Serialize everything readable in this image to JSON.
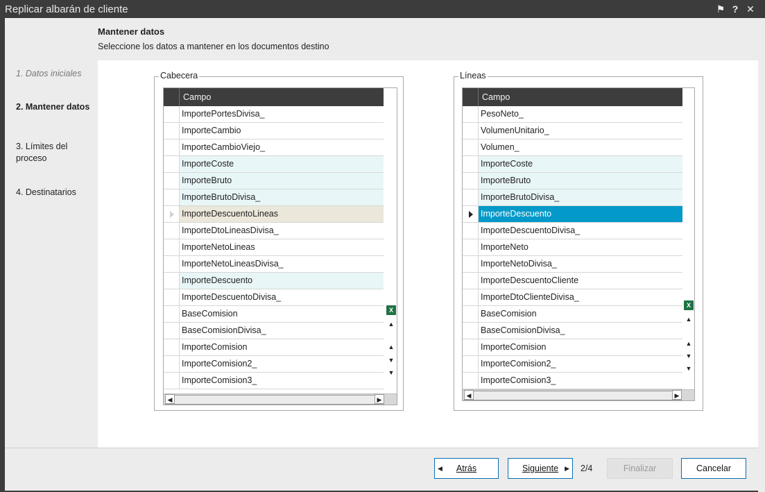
{
  "window": {
    "title": "Replicar albarán de cliente",
    "controls": {
      "pin": "⚑",
      "help": "?",
      "close": "✕"
    }
  },
  "header": {
    "title": "Mantener datos",
    "subtitle": "Seleccione los datos a mantener en los documentos destino"
  },
  "steps": [
    "1. Datos iniciales",
    "2. Mantener datos",
    "3. Límites del proceso",
    "4. Destinatarios"
  ],
  "cabecera": {
    "legend": "Cabecera",
    "column": "Campo",
    "rows": [
      {
        "value": "ImportePortesDivisa_",
        "state": "normal"
      },
      {
        "value": "ImporteCambio",
        "state": "normal"
      },
      {
        "value": "ImporteCambioViejo_",
        "state": "normal"
      },
      {
        "value": "ImporteCoste",
        "state": "light"
      },
      {
        "value": "ImporteBruto",
        "state": "light"
      },
      {
        "value": "ImporteBrutoDivisa_",
        "state": "light"
      },
      {
        "value": "ImporteDescuentoLineas",
        "state": "cursor"
      },
      {
        "value": "ImporteDtoLineasDivisa_",
        "state": "normal"
      },
      {
        "value": "ImporteNetoLineas",
        "state": "normal"
      },
      {
        "value": "ImporteNetoLineasDivisa_",
        "state": "normal"
      },
      {
        "value": "ImporteDescuento",
        "state": "light"
      },
      {
        "value": "ImporteDescuentoDivisa_",
        "state": "normal"
      },
      {
        "value": "BaseComision",
        "state": "normal"
      },
      {
        "value": "BaseComisionDivisa_",
        "state": "normal"
      },
      {
        "value": "ImporteComision",
        "state": "normal"
      },
      {
        "value": "ImporteComision2_",
        "state": "normal"
      },
      {
        "value": "ImporteComision3_",
        "state": "normal"
      }
    ]
  },
  "lineas": {
    "legend": "Líneas",
    "column": "Campo",
    "rows": [
      {
        "value": "PesoNeto_",
        "state": "normal"
      },
      {
        "value": "VolumenUnitario_",
        "state": "normal"
      },
      {
        "value": "Volumen_",
        "state": "normal"
      },
      {
        "value": "ImporteCoste",
        "state": "light"
      },
      {
        "value": "ImporteBruto",
        "state": "light"
      },
      {
        "value": "ImporteBrutoDivisa_",
        "state": "light"
      },
      {
        "value": "ImporteDescuento",
        "state": "active"
      },
      {
        "value": "ImporteDescuentoDivisa_",
        "state": "normal"
      },
      {
        "value": "ImporteNeto",
        "state": "normal"
      },
      {
        "value": "ImporteNetoDivisa_",
        "state": "normal"
      },
      {
        "value": "ImporteDescuentoCliente",
        "state": "normal"
      },
      {
        "value": "ImporteDtoClienteDivisa_",
        "state": "normal"
      },
      {
        "value": "BaseComision",
        "state": "normal"
      },
      {
        "value": "BaseComisionDivisa_",
        "state": "normal"
      },
      {
        "value": "ImporteComision",
        "state": "normal"
      },
      {
        "value": "ImporteComision2_",
        "state": "normal"
      },
      {
        "value": "ImporteComision3_",
        "state": "normal"
      }
    ]
  },
  "footer": {
    "back": "Atrás",
    "next": "Siguiente",
    "page": "2/4",
    "finish": "Finalizar",
    "cancel": "Cancelar"
  },
  "icons": {
    "excel": "excel-export-icon",
    "scroll_top": "▲",
    "scroll_up": "▲",
    "scroll_down": "▼",
    "scroll_bottom": "▼",
    "left": "◀",
    "right": "▶"
  },
  "colors": {
    "titlebar": "#3c3c3c",
    "grid_header": "#3d3d3d",
    "light_row": "#e9f6f8",
    "cursor_row": "#ebe7da",
    "active_row": "#0399c9",
    "button_border": "#0a6fb0"
  }
}
